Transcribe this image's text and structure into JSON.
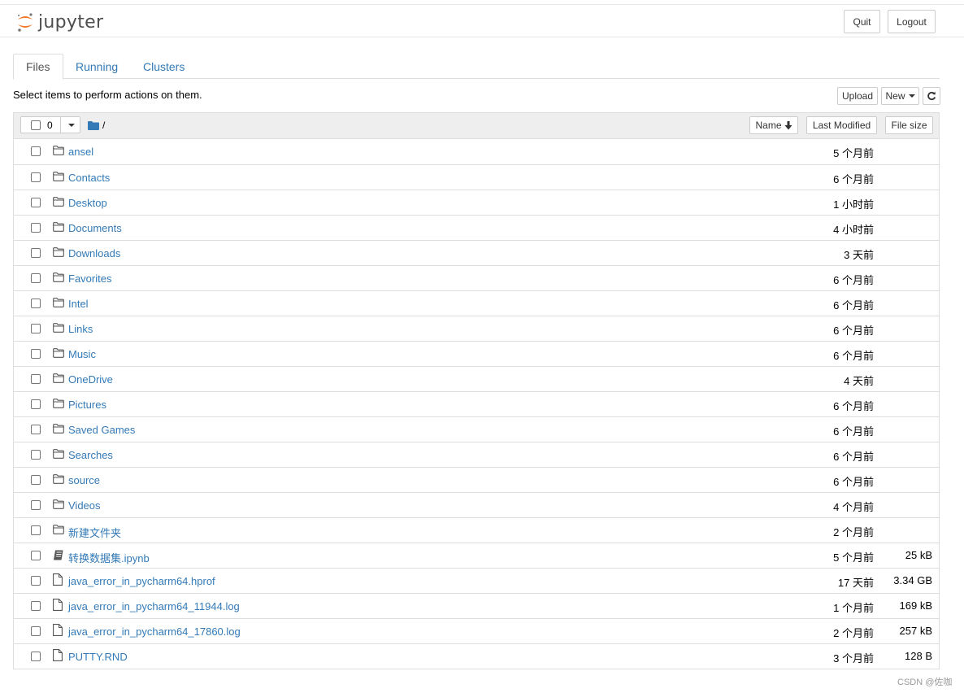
{
  "header": {
    "logo_text": "jupyter",
    "quit_label": "Quit",
    "logout_label": "Logout",
    "logo_colors": {
      "orange": "#f37726",
      "gray": "#767677"
    }
  },
  "tabs": [
    {
      "label": "Files",
      "active": true
    },
    {
      "label": "Running",
      "active": false
    },
    {
      "label": "Clusters",
      "active": false
    }
  ],
  "toolbar": {
    "instructions": "Select items to perform actions on them.",
    "upload_label": "Upload",
    "new_label": "New",
    "refresh_icon": "refresh-icon"
  },
  "list_header": {
    "selected_count": "0",
    "path": "/",
    "sort_name_label": "Name",
    "sort_modified_label": "Last Modified",
    "sort_size_label": "File size"
  },
  "files": [
    {
      "name": "ansel",
      "type": "folder",
      "modified": "5 个月前",
      "size": ""
    },
    {
      "name": "Contacts",
      "type": "folder",
      "modified": "6 个月前",
      "size": ""
    },
    {
      "name": "Desktop",
      "type": "folder",
      "modified": "1 小时前",
      "size": ""
    },
    {
      "name": "Documents",
      "type": "folder",
      "modified": "4 小时前",
      "size": ""
    },
    {
      "name": "Downloads",
      "type": "folder",
      "modified": "3 天前",
      "size": ""
    },
    {
      "name": "Favorites",
      "type": "folder",
      "modified": "6 个月前",
      "size": ""
    },
    {
      "name": "Intel",
      "type": "folder",
      "modified": "6 个月前",
      "size": ""
    },
    {
      "name": "Links",
      "type": "folder",
      "modified": "6 个月前",
      "size": ""
    },
    {
      "name": "Music",
      "type": "folder",
      "modified": "6 个月前",
      "size": ""
    },
    {
      "name": "OneDrive",
      "type": "folder",
      "modified": "4 天前",
      "size": ""
    },
    {
      "name": "Pictures",
      "type": "folder",
      "modified": "6 个月前",
      "size": ""
    },
    {
      "name": "Saved Games",
      "type": "folder",
      "modified": "6 个月前",
      "size": ""
    },
    {
      "name": "Searches",
      "type": "folder",
      "modified": "6 个月前",
      "size": ""
    },
    {
      "name": "source",
      "type": "folder",
      "modified": "6 个月前",
      "size": ""
    },
    {
      "name": "Videos",
      "type": "folder",
      "modified": "4 个月前",
      "size": ""
    },
    {
      "name": "新建文件夹",
      "type": "folder",
      "modified": "2 个月前",
      "size": ""
    },
    {
      "name": "转换数据集.ipynb",
      "type": "notebook",
      "modified": "5 个月前",
      "size": "25 kB"
    },
    {
      "name": "java_error_in_pycharm64.hprof",
      "type": "file",
      "modified": "17 天前",
      "size": "3.34 GB"
    },
    {
      "name": "java_error_in_pycharm64_11944.log",
      "type": "file",
      "modified": "1 个月前",
      "size": "169 kB"
    },
    {
      "name": "java_error_in_pycharm64_17860.log",
      "type": "file",
      "modified": "2 个月前",
      "size": "257 kB"
    },
    {
      "name": "PUTTY.RND",
      "type": "file",
      "modified": "3 个月前",
      "size": "128 B"
    }
  ],
  "watermark": "CSDN @佐咖",
  "colors": {
    "link": "#337ab7",
    "folder_icon": "#337ab7",
    "header_bg": "#eeeeee"
  }
}
